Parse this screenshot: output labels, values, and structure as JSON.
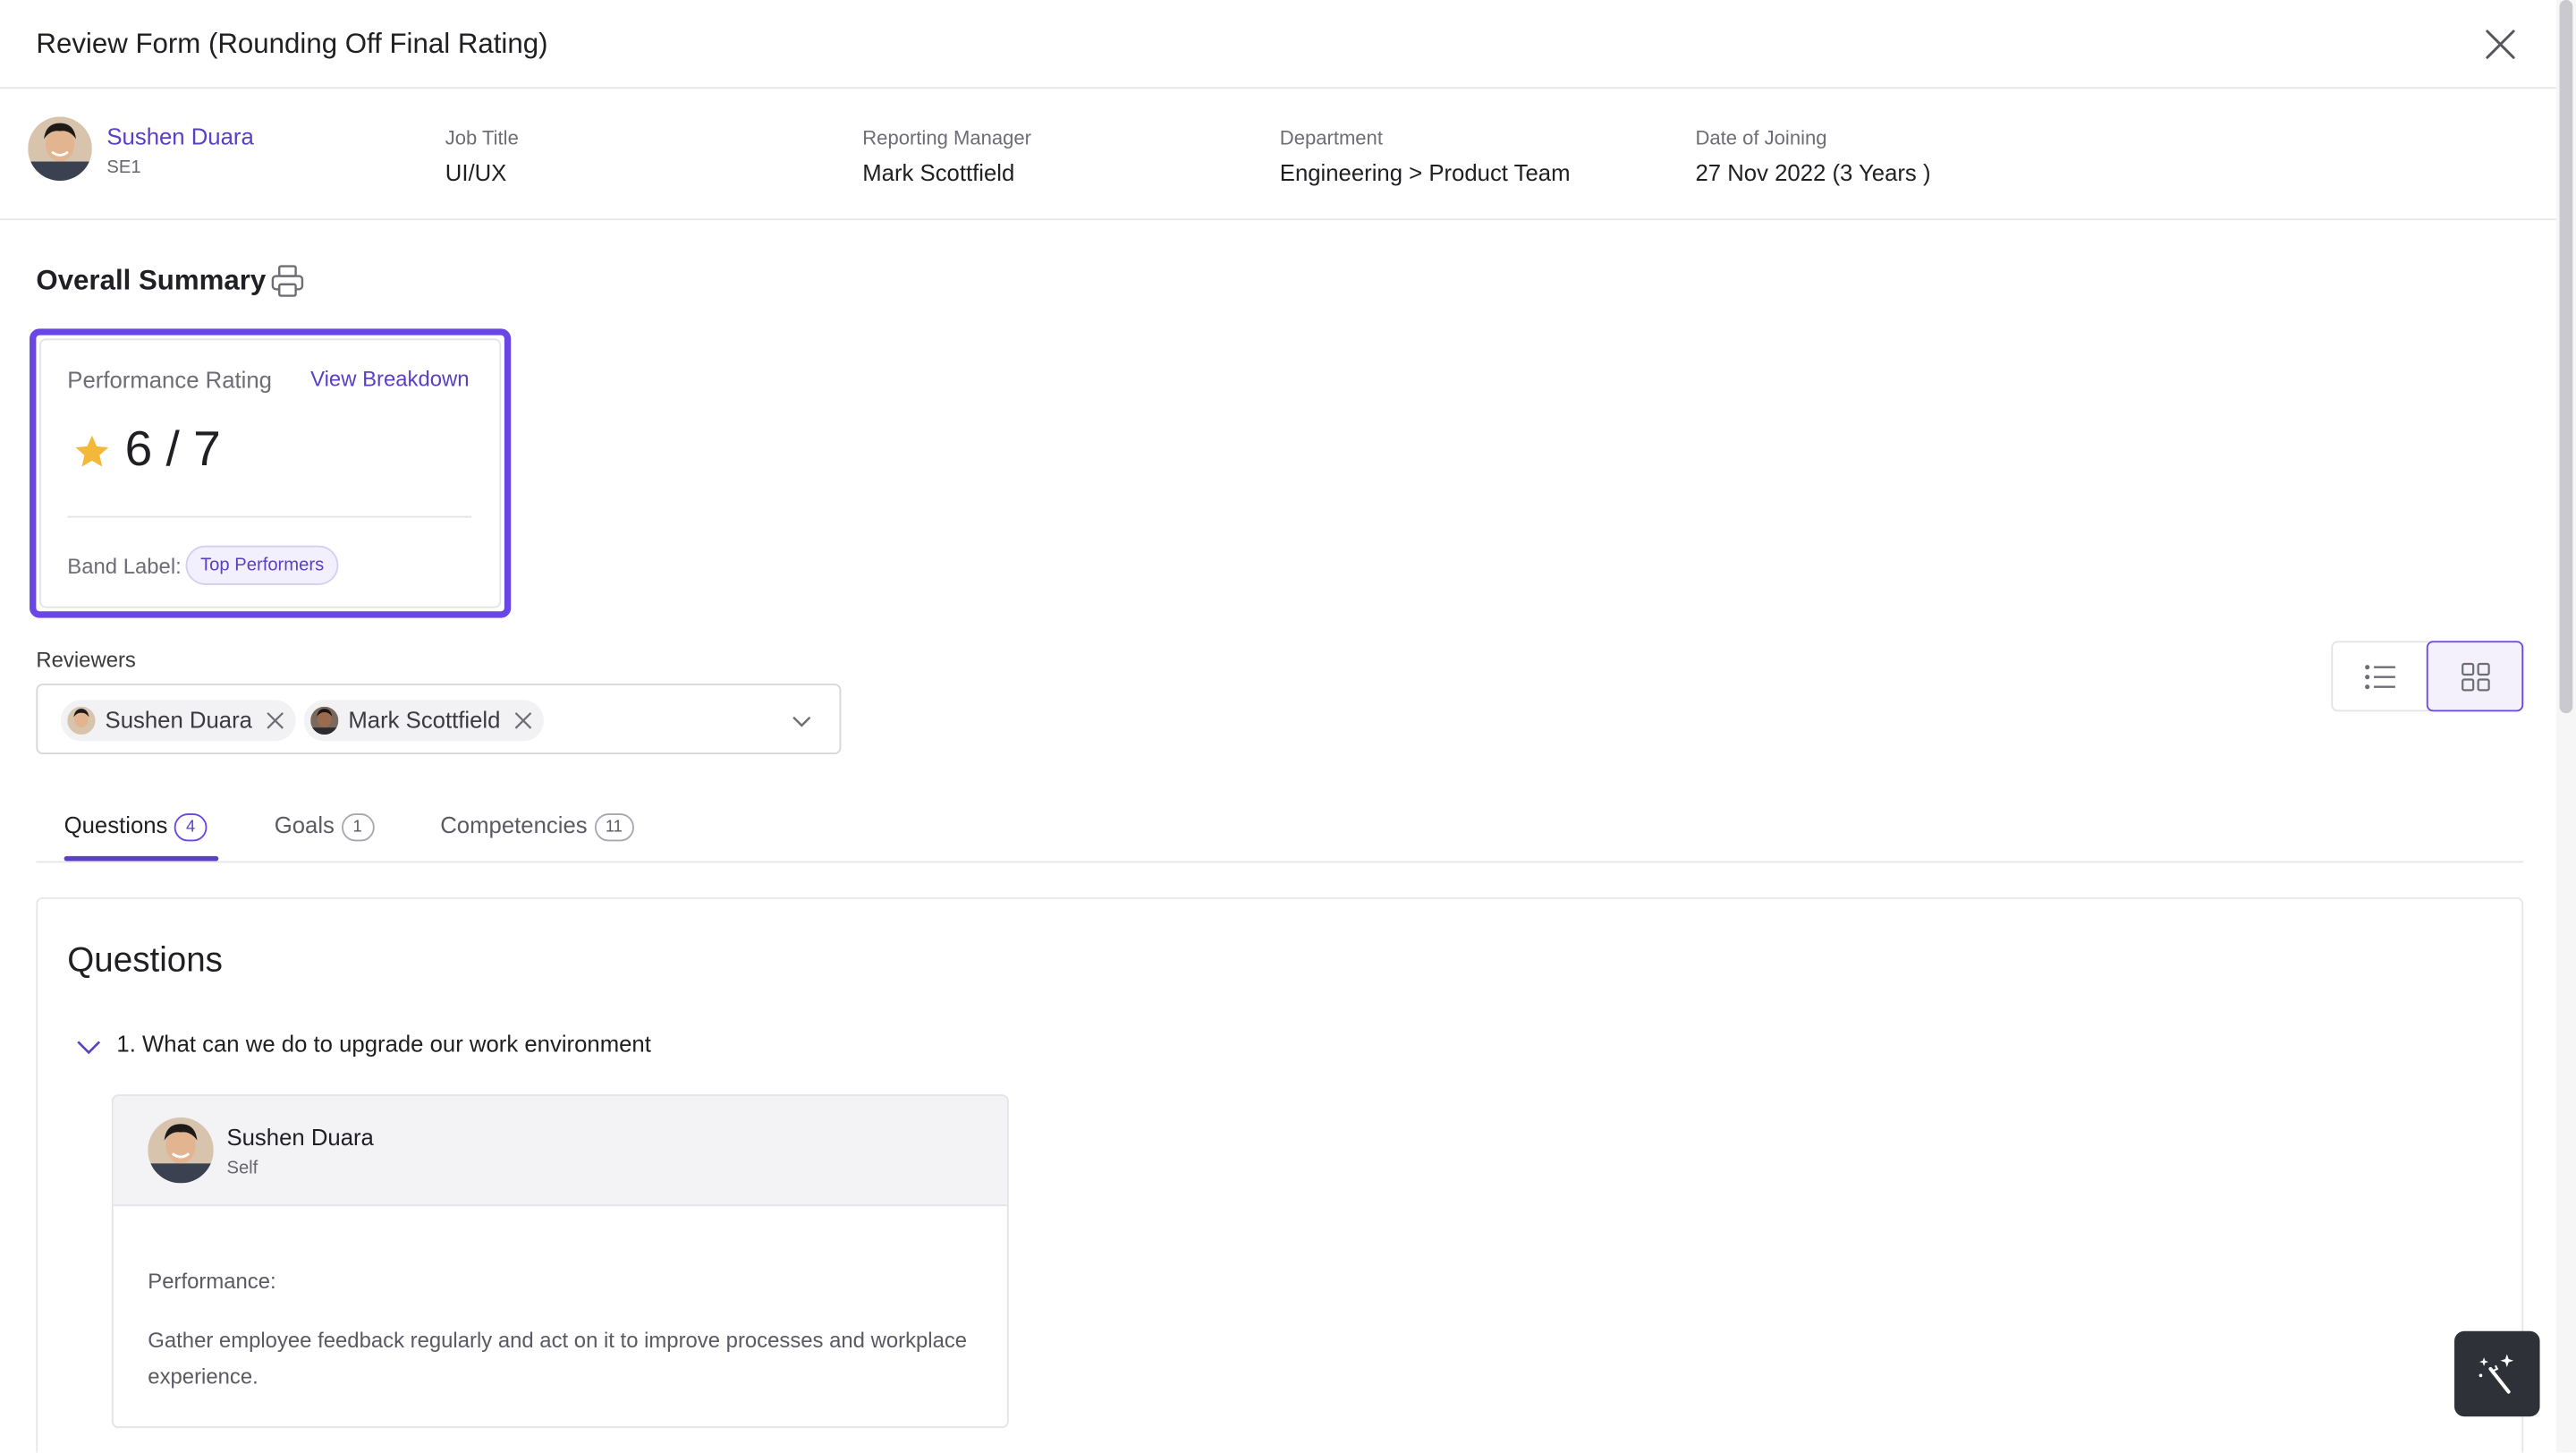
{
  "header": {
    "title": "Review Form (Rounding Off Final Rating)"
  },
  "employee": {
    "name": "Sushen Duara",
    "role": "SE1",
    "fields": [
      {
        "label": "Job Title",
        "value": "UI/UX"
      },
      {
        "label": "Reporting Manager",
        "value": "Mark Scottfield"
      },
      {
        "label": "Department",
        "value": "Engineering > Product Team"
      },
      {
        "label": "Date of Joining",
        "value": "27 Nov 2022 (3 Years )"
      }
    ]
  },
  "summary": {
    "title": "Overall Summary",
    "performance_label": "Performance Rating",
    "view_breakdown": "View Breakdown",
    "rating": "6 / 7",
    "band_label": "Band Label:",
    "band_value": "Top Performers"
  },
  "reviewers": {
    "label": "Reviewers",
    "selected": [
      "Sushen Duara",
      "Mark Scottfield"
    ]
  },
  "tabs": [
    {
      "label": "Questions",
      "count": "4",
      "active": true
    },
    {
      "label": "Goals",
      "count": "1",
      "active": false
    },
    {
      "label": "Competencies",
      "count": "11",
      "active": false
    }
  ],
  "questions": {
    "title": "Questions",
    "items": [
      {
        "text": "1. What can we do to upgrade our work environment",
        "response": {
          "name": "Sushen Duara",
          "role": "Self",
          "label": "Performance:",
          "body": "Gather employee feedback regularly and act on it to improve processes and workplace experience."
        }
      }
    ]
  },
  "colors": {
    "accent": "#5b3fc4",
    "highlight": "#6b46e6",
    "star": "#f3b73a",
    "fab": "#2e3138"
  },
  "icons": [
    "close-icon",
    "printer-icon",
    "star-icon",
    "chevron-down-icon",
    "list-view-icon",
    "grid-view-icon",
    "magic-wand-icon"
  ]
}
